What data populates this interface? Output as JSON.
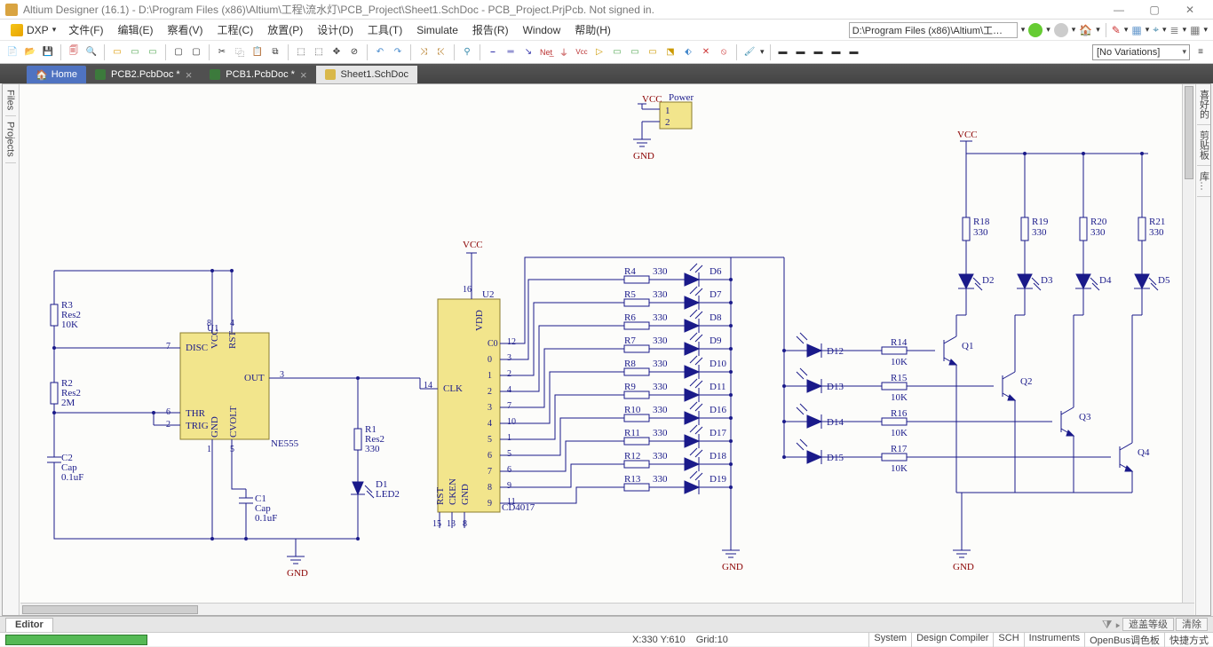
{
  "window": {
    "title": "Altium Designer (16.1) - D:\\Program Files (x86)\\Altium\\工程\\流水灯\\PCB_Project\\Sheet1.SchDoc - PCB_Project.PrjPcb. Not signed in.",
    "min": "—",
    "max": "▢",
    "close": "✕"
  },
  "menu": {
    "dxp": "DXP",
    "items": [
      "文件(F)",
      "编辑(E)",
      "察看(V)",
      "工程(C)",
      "放置(P)",
      "设计(D)",
      "工具(T)",
      "Simulate",
      "报告(R)",
      "Window",
      "帮助(H)"
    ],
    "path": "D:\\Program Files (x86)\\Altium\\工…"
  },
  "toolbar": {
    "variation": "[No Variations]"
  },
  "tabs": {
    "home": "Home",
    "docs": [
      "PCB2.PcbDoc *",
      "PCB1.PcbDoc *",
      "Sheet1.SchDoc"
    ],
    "activeIndex": 2
  },
  "sidepanels": {
    "left": [
      "Files",
      "Projects"
    ],
    "right": [
      "喜好的",
      "剪贴板",
      "库…"
    ]
  },
  "editor": {
    "tab": "Editor",
    "right": [
      "遮盖等级",
      "清除"
    ]
  },
  "status": {
    "coord": "X:330 Y:610",
    "grid": "Grid:10",
    "panels": [
      "System",
      "Design Compiler",
      "SCH",
      "Instruments",
      "OpenBus调色板",
      "快捷方式"
    ]
  },
  "schematic": {
    "power": {
      "vcc": "VCC",
      "gnd": "GND",
      "header": "Power",
      "pins": [
        "1",
        "2"
      ]
    },
    "u1": {
      "ref": "U1",
      "part": "NE555",
      "pins": {
        "disc": "DISC",
        "vcc": "VCC",
        "rst": "RST",
        "out": "OUT",
        "thr": "THR",
        "trig": "TRIG",
        "gnd": "GND",
        "cvolt": "CVOLT"
      },
      "pinnums": {
        "disc": "7",
        "vcc": "8",
        "rst": "4",
        "out": "3",
        "thr": "6",
        "trig": "2",
        "gnd": "1",
        "cvolt": "5"
      }
    },
    "u2": {
      "ref": "U2",
      "part": "CD4017",
      "vdd": "VDD",
      "clk": "CLK",
      "rst": "RST",
      "cken": "CKEN",
      "gnd": "GND",
      "clkpin": "14",
      "vddpin": "16",
      "rstpin": "15",
      "ckenpin": "13",
      "gndpin": "8",
      "outs": [
        {
          "lbl": "C0",
          "num": "12"
        },
        {
          "lbl": "0",
          "num": "3"
        },
        {
          "lbl": "1",
          "num": "2"
        },
        {
          "lbl": "2",
          "num": "4"
        },
        {
          "lbl": "3",
          "num": "7"
        },
        {
          "lbl": "4",
          "num": "10"
        },
        {
          "lbl": "5",
          "num": "1"
        },
        {
          "lbl": "6",
          "num": "5"
        },
        {
          "lbl": "7",
          "num": "6"
        },
        {
          "lbl": "8",
          "num": "9"
        },
        {
          "lbl": "9",
          "num": "11"
        }
      ]
    },
    "net_vcc_u1": "VCC",
    "gnd_labels": [
      "GND",
      "GND",
      "GND",
      "GND"
    ],
    "r_u1": [
      {
        "ref": "R3",
        "type": "Res2",
        "val": "10K"
      },
      {
        "ref": "R2",
        "type": "Res2",
        "val": "2M"
      }
    ],
    "c_u1": [
      {
        "ref": "C2",
        "type": "Cap",
        "val": "0.1uF"
      },
      {
        "ref": "C1",
        "type": "Cap",
        "val": "0.1uF"
      }
    ],
    "r1": {
      "ref": "R1",
      "type": "Res2",
      "val": "330"
    },
    "d1": {
      "ref": "D1",
      "type": "LED2"
    },
    "outR": [
      {
        "ref": "R4",
        "val": "330"
      },
      {
        "ref": "R5",
        "val": "330"
      },
      {
        "ref": "R6",
        "val": "330"
      },
      {
        "ref": "R7",
        "val": "330"
      },
      {
        "ref": "R8",
        "val": "330"
      },
      {
        "ref": "R9",
        "val": "330"
      },
      {
        "ref": "R10",
        "val": "330"
      },
      {
        "ref": "R11",
        "val": "330"
      },
      {
        "ref": "R12",
        "val": "330"
      },
      {
        "ref": "R13",
        "val": "330"
      }
    ],
    "outD": [
      "D6",
      "D7",
      "D8",
      "D9",
      "D10",
      "D11",
      "D16",
      "D17",
      "D18",
      "D19"
    ],
    "vcc_bus2": "VCC",
    "topR": [
      {
        "ref": "R18",
        "val": "330"
      },
      {
        "ref": "R19",
        "val": "330"
      },
      {
        "ref": "R20",
        "val": "330"
      },
      {
        "ref": "R21",
        "val": "330"
      }
    ],
    "topD": [
      "D2",
      "D3",
      "D4",
      "D5"
    ],
    "sideD": [
      "D12",
      "D13",
      "D14",
      "D15"
    ],
    "sideR": [
      {
        "ref": "R14",
        "val": "10K"
      },
      {
        "ref": "R15",
        "val": "10K"
      },
      {
        "ref": "R16",
        "val": "10K"
      },
      {
        "ref": "R17",
        "val": "10K"
      }
    ],
    "q": [
      "Q1",
      "Q2",
      "Q3",
      "Q4"
    ]
  }
}
